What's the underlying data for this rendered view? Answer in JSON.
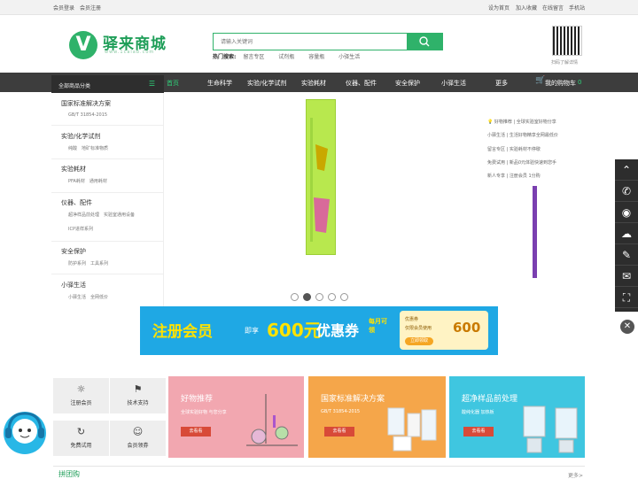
{
  "topbar": {
    "left": [
      "会员登录",
      "会员注册"
    ],
    "right": [
      "设为首页",
      "加入收藏",
      "在线留言",
      "手机站"
    ]
  },
  "logo": {
    "mark": "V",
    "name": "驿来商城",
    "url": "www.1calab.com"
  },
  "search": {
    "placeholder": "请输入关键词",
    "hot_label": "热门搜索:",
    "hot_items": [
      "留言专区",
      "试剂瓶",
      "容量瓶",
      "小驿生活"
    ]
  },
  "qr": {
    "caption": "扫码了解详情"
  },
  "nav": {
    "category_label": "全部商品分类",
    "items": [
      "首页",
      "生命科学",
      "实验/化学试剂",
      "实验耗材",
      "仪器、配件",
      "安全保护",
      "小驿生活",
      "更多"
    ],
    "cart": "我的购物车",
    "cart_count": "0"
  },
  "categories": [
    {
      "title": "国家标准解决方案",
      "subs": [
        "GB/T 31854-2015"
      ]
    },
    {
      "title": "实验/化学试剂",
      "subs": [
        "纯酸",
        "地矿标准物质"
      ]
    },
    {
      "title": "实验耗材",
      "subs": [
        "PFA耗材",
        "通用耗材"
      ]
    },
    {
      "title": "仪器、配件",
      "subs": [
        "超净样品前处理",
        "实验室通用设备"
      ],
      "subs2": [
        "ICP进样系列"
      ]
    },
    {
      "title": "安全保护",
      "subs": [
        "防护系列",
        "工具系列"
      ]
    },
    {
      "title": "小驿生活",
      "subs": [
        "小驿生活",
        "全网低价"
      ]
    }
  ],
  "news": [
    "好物推荐 | 全球实验室好物分享",
    "小驿生活 | 生活好物精享全网最低价",
    "留言专区 | 实验耗材不停歇",
    "免费试用 | 新品0元体验快速到您手",
    "新人专享 | 注册会员 1分购"
  ],
  "banner": {
    "title": "注册会员",
    "sub": "即享",
    "price": "600元",
    "coupon": "优惠券",
    "monthly": "每月可领",
    "card_title": "优惠券",
    "card_line": "仅限会员使用",
    "card_btn": "立即领取",
    "card_value": "600"
  },
  "services": [
    "注册会员",
    "技术支持",
    "免费试用",
    "会员领券"
  ],
  "cards": [
    {
      "title": "好物推荐",
      "sub": "全球实验好物 与您分享",
      "btn": "去看看",
      "color": "#f2a7b0"
    },
    {
      "title": "国家标准解决方案",
      "sub": "GB/T 31854-2015",
      "btn": "去看看",
      "color": "#f5a64a"
    },
    {
      "title": "超净样品前处理",
      "sub": "酸纯化器 加热板",
      "btn": "去看看",
      "color": "#3fc6e0"
    }
  ],
  "group": {
    "title": "拼团购",
    "more": "更多>"
  }
}
